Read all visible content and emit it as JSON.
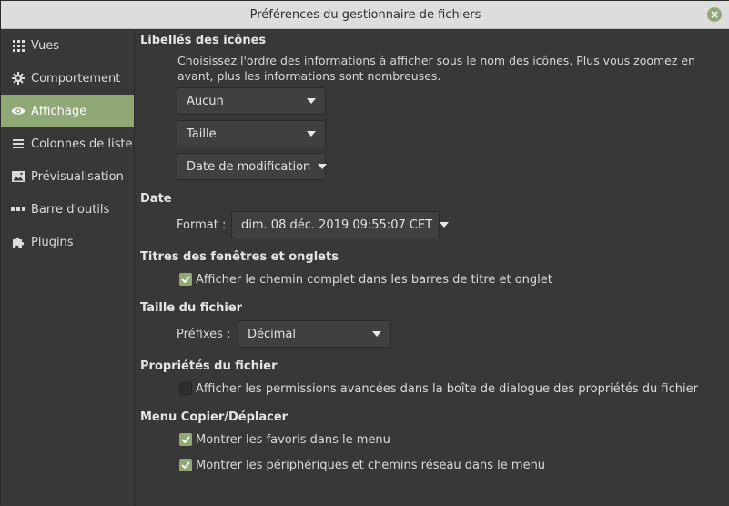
{
  "window": {
    "title": "Préférences du gestionnaire de fichiers"
  },
  "sidebar": {
    "items": [
      {
        "label": "Vues",
        "icon": "grid-dots-icon"
      },
      {
        "label": "Comportement",
        "icon": "gear-icon"
      },
      {
        "label": "Affichage",
        "icon": "eye-icon",
        "active": true
      },
      {
        "label": "Colonnes de liste",
        "icon": "list-icon"
      },
      {
        "label": "Prévisualisation",
        "icon": "image-icon"
      },
      {
        "label": "Barre d'outils",
        "icon": "toolbar-dots-icon"
      },
      {
        "label": "Plugins",
        "icon": "puzzle-icon"
      }
    ]
  },
  "icon_captions": {
    "heading": "Libellés des icônes",
    "description": "Choisissez l'ordre des informations à afficher sous le nom des icônes. Plus vous zoomez en avant, plus les informations sont nombreuses.",
    "options": [
      "Aucun",
      "Taille",
      "Date de modification"
    ]
  },
  "date": {
    "heading": "Date",
    "format_label": "Format :",
    "format_value": "dim. 08 déc. 2019 09:55:07 CET"
  },
  "window_titles": {
    "heading": "Titres des fenêtres et onglets",
    "full_path_label": "Afficher le chemin complet dans les barres de titre et onglet",
    "full_path_checked": true
  },
  "file_size": {
    "heading": "Taille du fichier",
    "prefixes_label": "Préfixes :",
    "prefixes_value": "Décimal"
  },
  "file_properties": {
    "heading": "Propriétés du fichier",
    "advanced_permissions_label": "Afficher les permissions avancées dans la boîte de dialogue des propriétés du fichier",
    "advanced_permissions_checked": false
  },
  "copy_move_menu": {
    "heading": "Menu Copier/Déplacer",
    "favorites_label": "Montrer les favoris dans le menu",
    "favorites_checked": true,
    "devices_label": "Montrer les périphériques et chemins réseau dans le menu",
    "devices_checked": true
  },
  "colors": {
    "accent": "#8fa876",
    "background": "#383838",
    "titlebar": "#dddddd"
  }
}
